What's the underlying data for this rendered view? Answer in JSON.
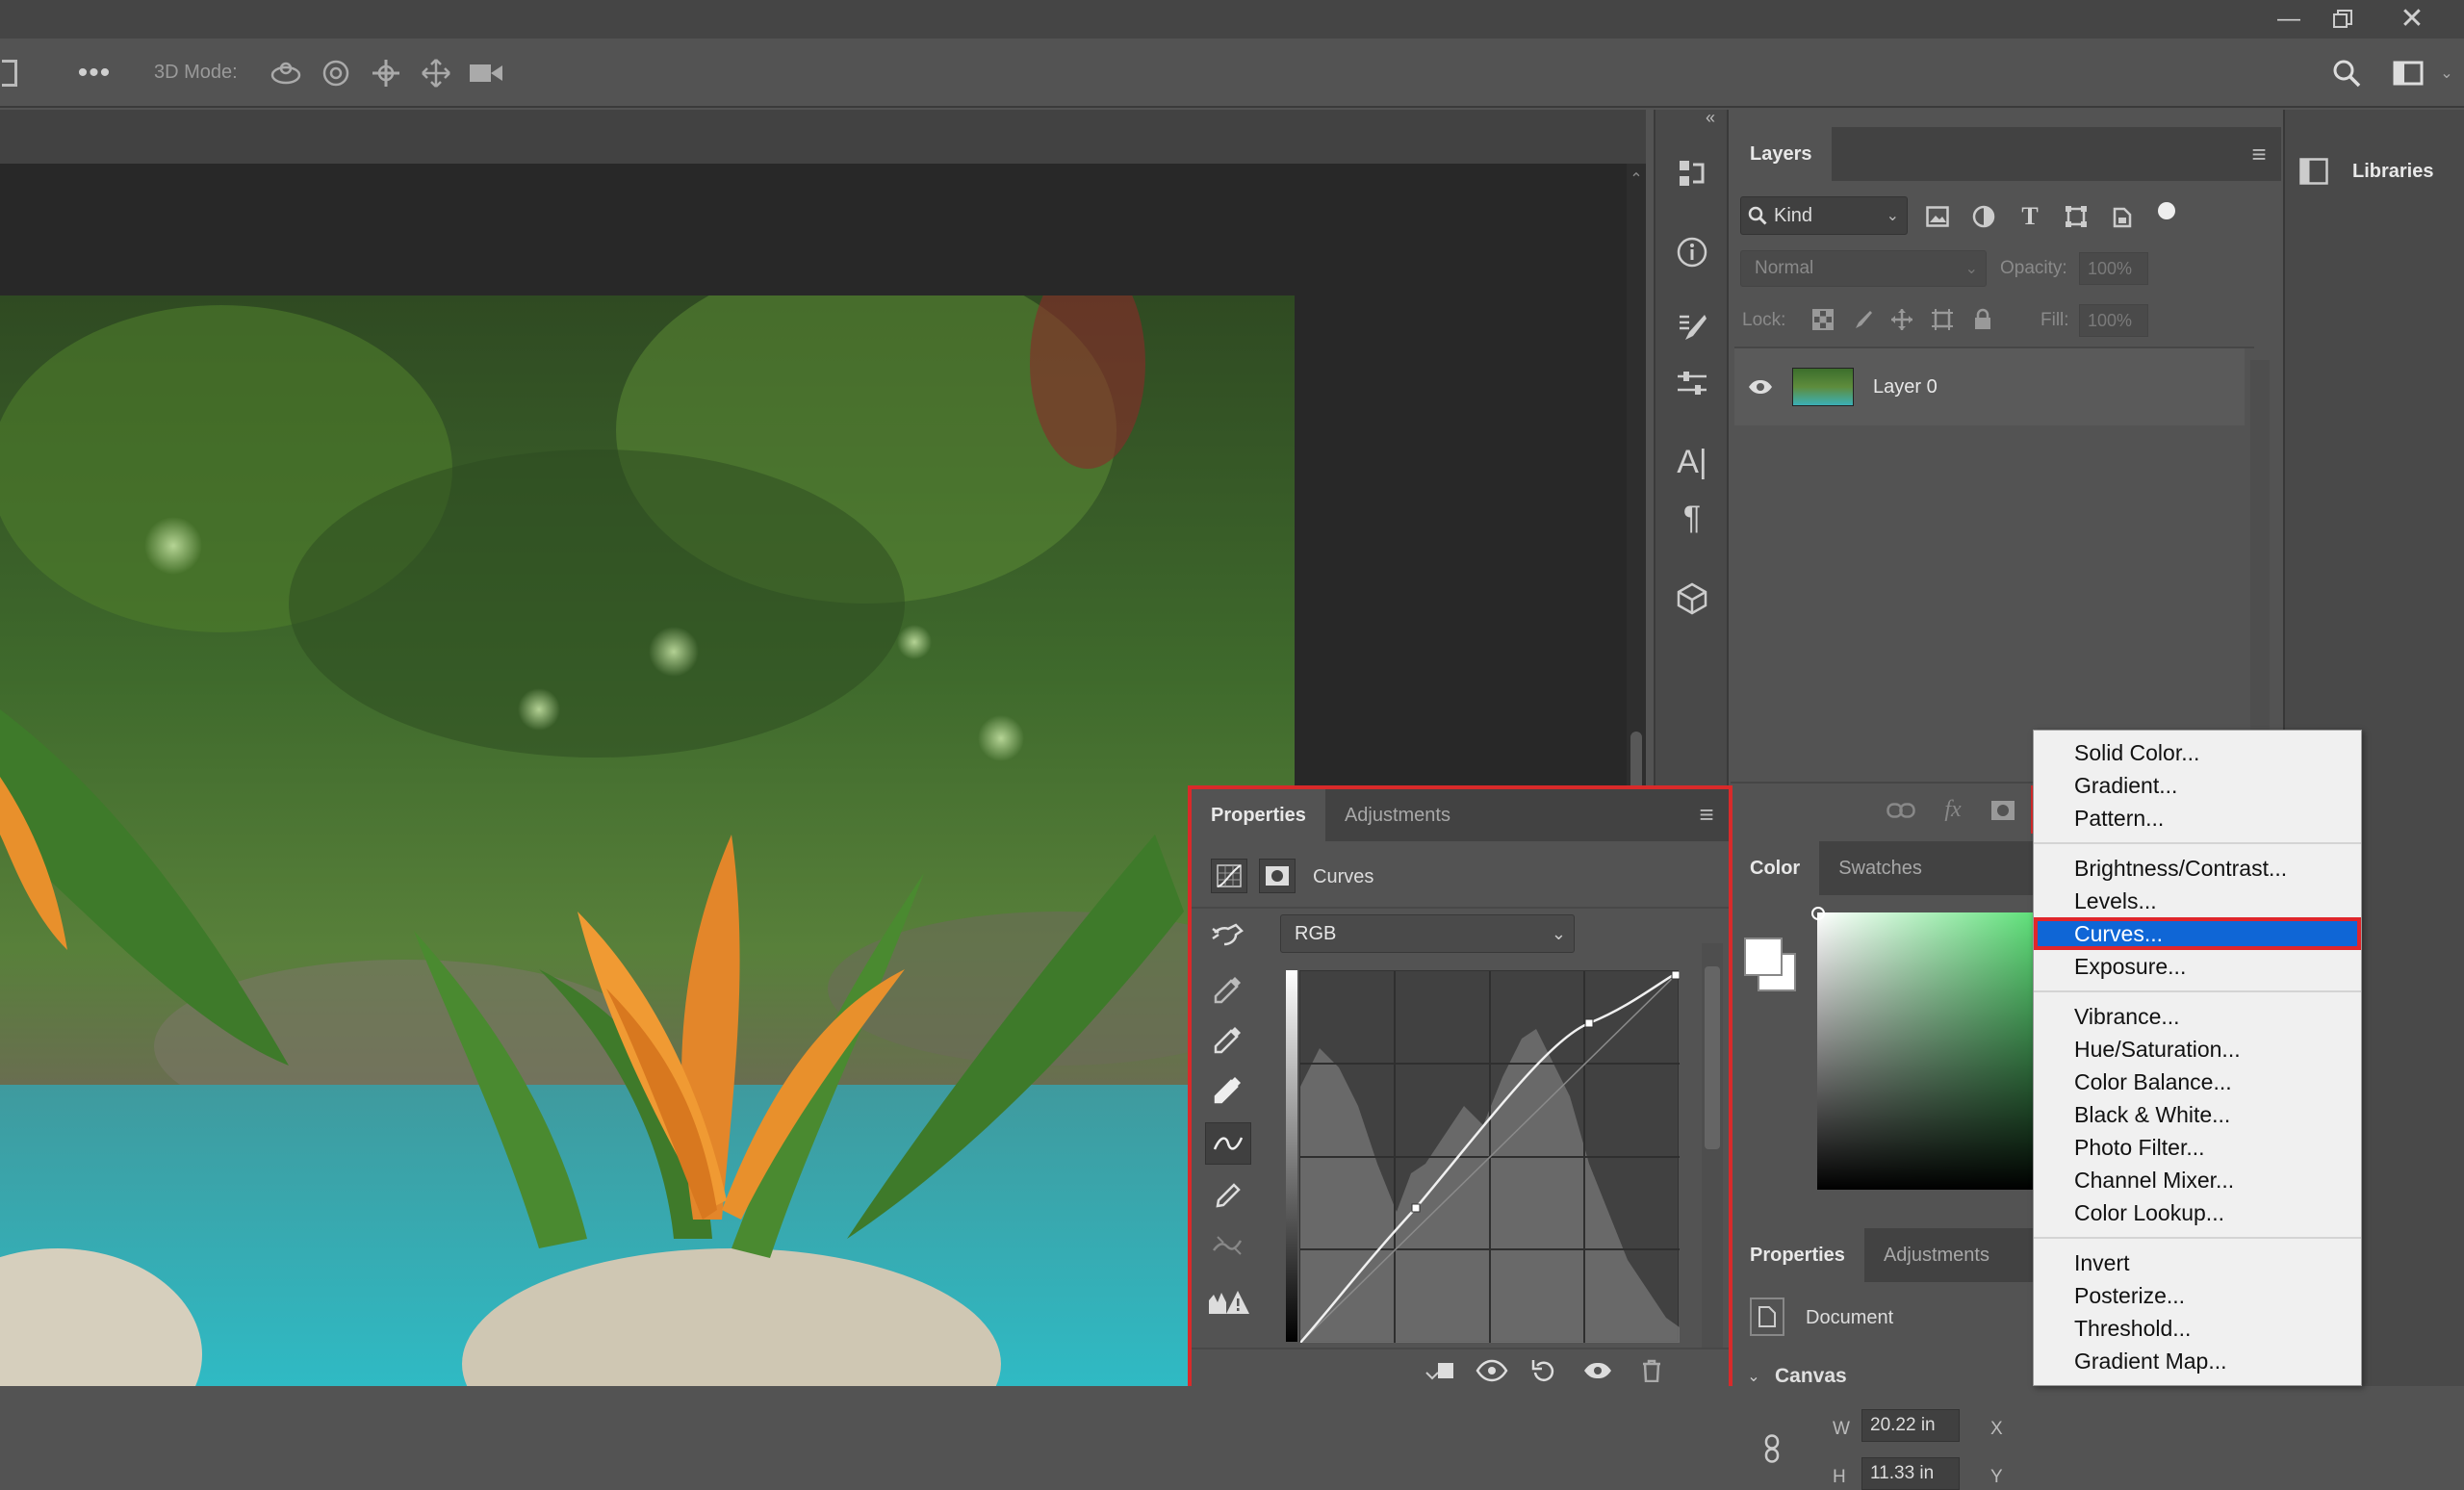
{
  "options_bar": {
    "label_3d_mode": "3D Mode:"
  },
  "layers_panel": {
    "tab_label": "Layers",
    "filter_kind": "Kind",
    "blend_mode": "Normal",
    "opacity_label": "Opacity:",
    "opacity_value": "100%",
    "lock_label": "Lock:",
    "fill_label": "Fill:",
    "fill_value": "100%",
    "layers": [
      {
        "name": "Layer 0",
        "visible": true
      }
    ]
  },
  "libraries": {
    "label": "Libraries"
  },
  "color_panel": {
    "tabs": [
      "Color",
      "Swatches"
    ]
  },
  "properties_bottom": {
    "tabs": [
      "Properties",
      "Adjustments"
    ],
    "document_label": "Document",
    "canvas_label": "Canvas",
    "w_label": "W",
    "w_value": "20.22 in",
    "h_label": "H",
    "h_value": "11.33 in",
    "x_label": "X",
    "y_label": "Y"
  },
  "curves_panel": {
    "tabs": [
      "Properties",
      "Adjustments"
    ],
    "title": "Curves",
    "channel": "RGB"
  },
  "adjustment_menu": {
    "groups": [
      [
        "Solid Color...",
        "Gradient...",
        "Pattern..."
      ],
      [
        "Brightness/Contrast...",
        "Levels...",
        "Curves...",
        "Exposure..."
      ],
      [
        "Vibrance...",
        "Hue/Saturation...",
        "Color Balance...",
        "Black & White...",
        "Photo Filter...",
        "Channel Mixer...",
        "Color Lookup..."
      ],
      [
        "Invert",
        "Posterize...",
        "Threshold...",
        "Gradient Map..."
      ]
    ],
    "selected": "Curves..."
  },
  "colors": {
    "accent_red": "#d92a2a",
    "menu_selection": "#0f66d6"
  }
}
